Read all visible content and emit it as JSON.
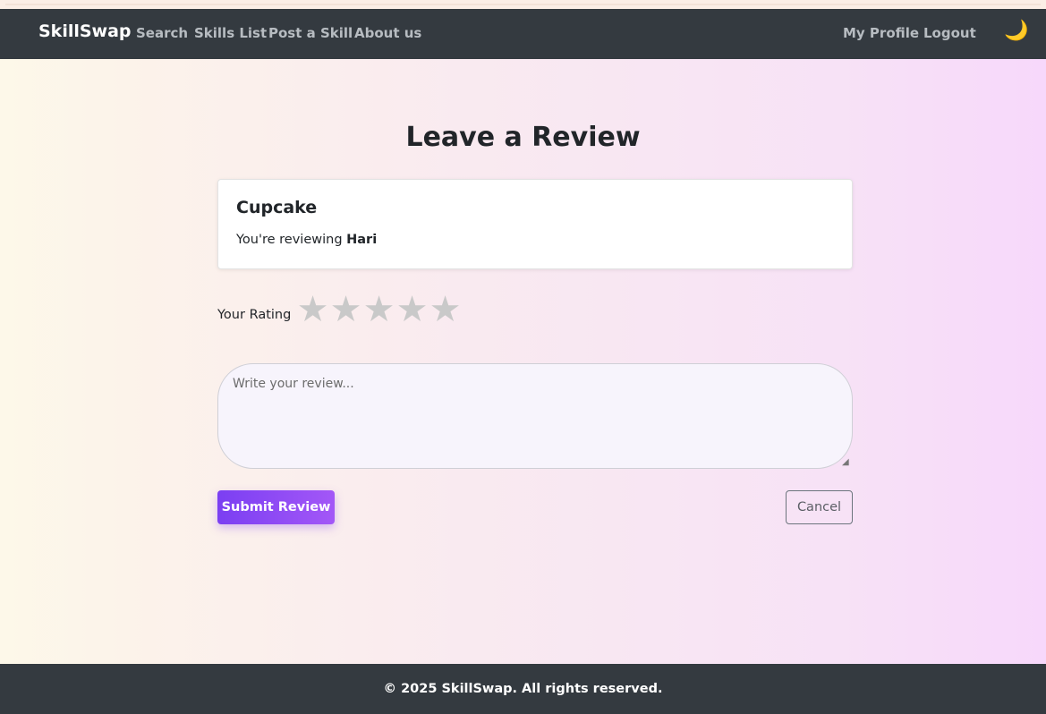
{
  "navbar": {
    "brand": "SkillSwap",
    "links": [
      "Search",
      "Skills List",
      "Post a Skill",
      "About us"
    ],
    "right_links": [
      "My Profile",
      "Logout"
    ],
    "theme_toggle_icon": "moon-icon",
    "background": "#343a40"
  },
  "page": {
    "title": "Leave a Review"
  },
  "card": {
    "skill_name": "Cupcake",
    "reviewing_prefix": "You're reviewing",
    "reviewee": "Hari"
  },
  "rating": {
    "label": "Your Rating",
    "max_stars": 5,
    "selected": 0,
    "star_glyph": "★",
    "empty_color": "#c9c9c9"
  },
  "review": {
    "placeholder": "Write your review...",
    "value": ""
  },
  "actions": {
    "submit_label": "Submit Review",
    "cancel_label": "Cancel",
    "submit_color": "#8a4af5"
  },
  "footer": {
    "text": "© 2025 SkillSwap. All rights reserved."
  }
}
